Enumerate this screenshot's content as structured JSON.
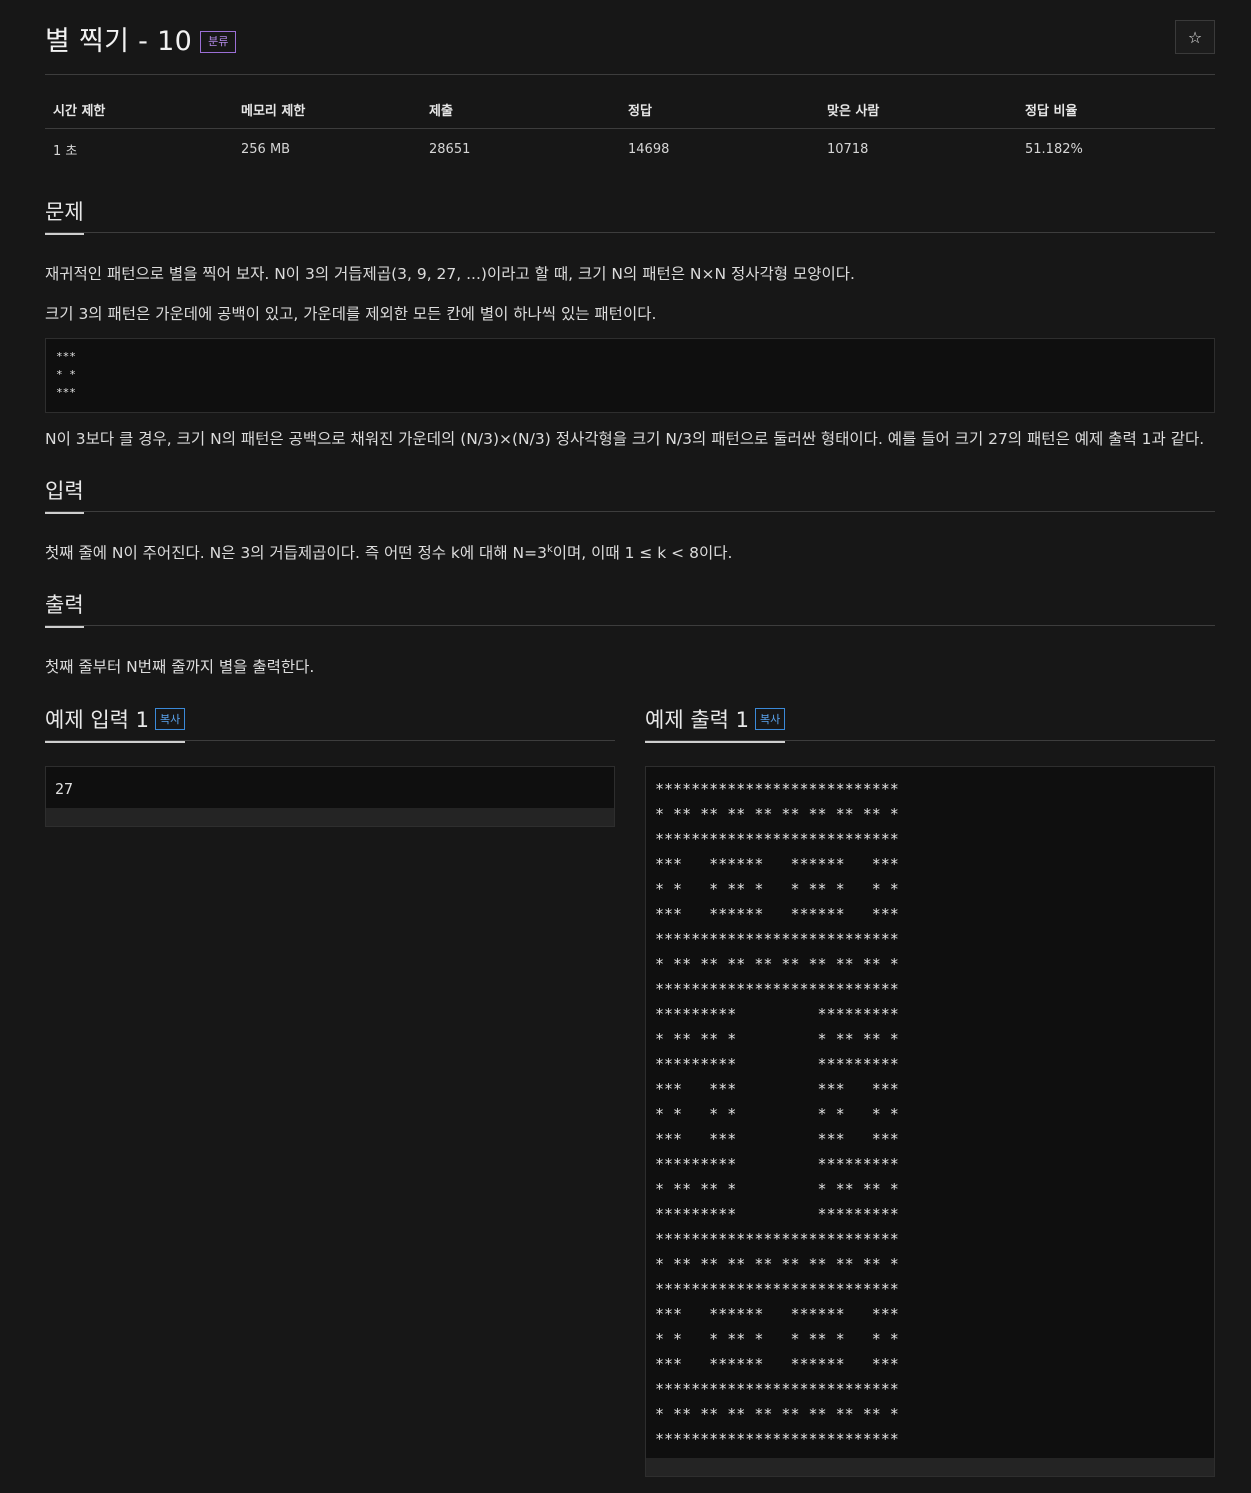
{
  "problem": {
    "title": "별 찍기 - 10",
    "category_badge": "분류",
    "favorite_icon": "star-outline-icon"
  },
  "stats": {
    "headers": [
      "시간 제한",
      "메모리 제한",
      "제출",
      "정답",
      "맞은 사람",
      "정답 비율"
    ],
    "values": [
      "1 초",
      "256 MB",
      "28651",
      "14698",
      "10718",
      "51.182%"
    ]
  },
  "sections": {
    "problem": {
      "heading": "문제",
      "para1": "재귀적인 패턴으로 별을 찍어 보자. N이 3의 거듭제곱(3, 9, 27, ...)이라고 할 때, 크기 N의 패턴은 N×N 정사각형 모양이다.",
      "para2": "크기 3의 패턴은 가운데에 공백이 있고, 가운데를 제외한 모든 칸에 별이 하나씩 있는 패턴이다.",
      "code": "***\n* *\n***",
      "para3": "N이 3보다 클 경우, 크기 N의 패턴은 공백으로 채워진 가운데의 (N/3)×(N/3) 정사각형을 크기 N/3의 패턴으로 둘러싼 형태이다. 예를 들어 크기 27의 패턴은 예제 출력 1과 같다."
    },
    "input": {
      "heading": "입력",
      "text_before_sup": "첫째 줄에 N이 주어진다. N은 3의 거듭제곱이다. 즉 어떤 정수 k에 대해 N=3",
      "sup": "k",
      "text_after_sup": "이며, 이때 1 ≤ k < 8이다."
    },
    "output": {
      "heading": "출력",
      "text": "첫째 줄부터 N번째 줄까지 별을 출력한다."
    }
  },
  "samples": {
    "input": {
      "heading": "예제 입력 1",
      "copy_label": "복사",
      "content": "27"
    },
    "output": {
      "heading": "예제 출력 1",
      "copy_label": "복사",
      "content": "***************************\n* ** ** ** ** ** ** ** ** *\n***************************\n***   ******   ******   ***\n* *   * ** *   * ** *   * *\n***   ******   ******   ***\n***************************\n* ** ** ** ** ** ** ** ** *\n***************************\n*********         *********\n* ** ** *         * ** ** *\n*********         *********\n***   ***         ***   ***\n* *   * *         * *   * *\n***   ***         ***   ***\n*********         *********\n* ** ** *         * ** ** *\n*********         *********\n***************************\n* ** ** ** ** ** ** ** ** *\n***************************\n***   ******   ******   ***\n* *   * ** *   * ** *   * *\n***   ******   ******   ***\n***************************\n* ** ** ** ** ** ** ** ** *\n***************************"
    }
  }
}
